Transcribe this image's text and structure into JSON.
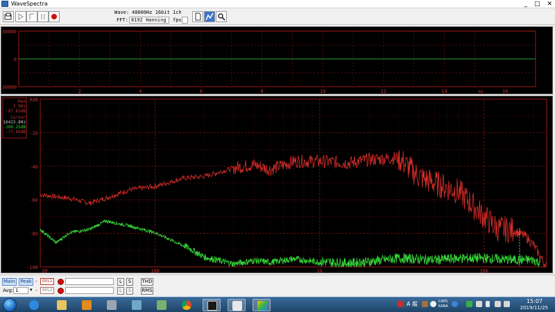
{
  "window": {
    "title": "WaveSpectra",
    "controls": [
      "_",
      "□",
      "✕"
    ]
  },
  "toolbar": {
    "wave_label": "Wave:",
    "wave_value": "48000Hz 16bit 1ch",
    "fft_label": "FFT:",
    "fft_value": "8192 Hanning",
    "fps_label": "fps:"
  },
  "wave_plot": {
    "y_ticks": [
      "30000",
      "0",
      "-30000"
    ],
    "x_ticks": [
      "2",
      "4",
      "6",
      "8",
      "10",
      "12",
      "14",
      "16"
    ],
    "x_unit": "ms",
    "colors": {
      "grid": "#7a1010",
      "trace": "#27a53a",
      "frame": "#a01818"
    }
  },
  "spectrum_plot": {
    "y_ticks": [
      "0dB",
      "-20",
      "-40",
      "-60",
      "-80",
      "-100"
    ],
    "x_ticks": [
      "20",
      "100",
      "1k",
      "10k"
    ],
    "readout": {
      "max_label": "Max",
      "max_freq": "5.9Hz",
      "max_level": "-67.83dB",
      "cursor_label": "Cursor",
      "cursor_freq": "16423.8Hz",
      "cursor_level_1": "-109.25dB",
      "cursor_level_2": "-77.89dB"
    },
    "colors": {
      "red_trace": "#e0302c",
      "green_trace": "#37d93a",
      "grid": "#7a1010",
      "label": "#c83030"
    }
  },
  "chart_data": {
    "type": "line",
    "xscale": "log",
    "xlim": [
      20,
      24000
    ],
    "ylim": [
      -100,
      0
    ],
    "series": [
      {
        "x": [
          20,
          30,
          40,
          50,
          70,
          100,
          150,
          200,
          300,
          400,
          500,
          700,
          1000,
          1500,
          2000,
          3000,
          4000,
          5000,
          7000,
          10000,
          12000,
          15000,
          18000,
          20000,
          22000,
          24000
        ],
        "y": [
          -57,
          -59,
          -62,
          -59,
          -54,
          -52,
          -47,
          -46,
          -41,
          -39,
          -42,
          -37,
          -37,
          -38,
          -36,
          -35,
          -46,
          -50,
          -55,
          -70,
          -77,
          -78,
          -82,
          -87,
          -94,
          -100
        ]
      },
      {
        "x": [
          20,
          25,
          30,
          40,
          50,
          70,
          100,
          150,
          200,
          300,
          400,
          500,
          700,
          1000,
          1500,
          2000,
          3000,
          5000,
          7000,
          10000,
          15000,
          20000,
          22000
        ],
        "y": [
          -78,
          -86,
          -80,
          -78,
          -73,
          -76,
          -80,
          -88,
          -95,
          -99,
          -97,
          -98,
          -96,
          -98,
          -99,
          -98,
          -96,
          -97,
          -96,
          -96,
          -97,
          -97,
          -99
        ]
      }
    ]
  },
  "controls": {
    "main_label": "Main",
    "peak_label": "Peak",
    "avg_label": "Avg:",
    "avg_value": "1",
    "ovl1_label": "OVL1",
    "ovl2_label": "OVL2",
    "l_label": "L",
    "s_label": "S",
    "thd_label": "THD",
    "rms_label": "RMS"
  },
  "taskbar": {
    "tray_text_1": "A 般",
    "caps_label": "CAPS",
    "kana_label": "KANA",
    "time": "15:07",
    "date": "2019/11/25"
  }
}
